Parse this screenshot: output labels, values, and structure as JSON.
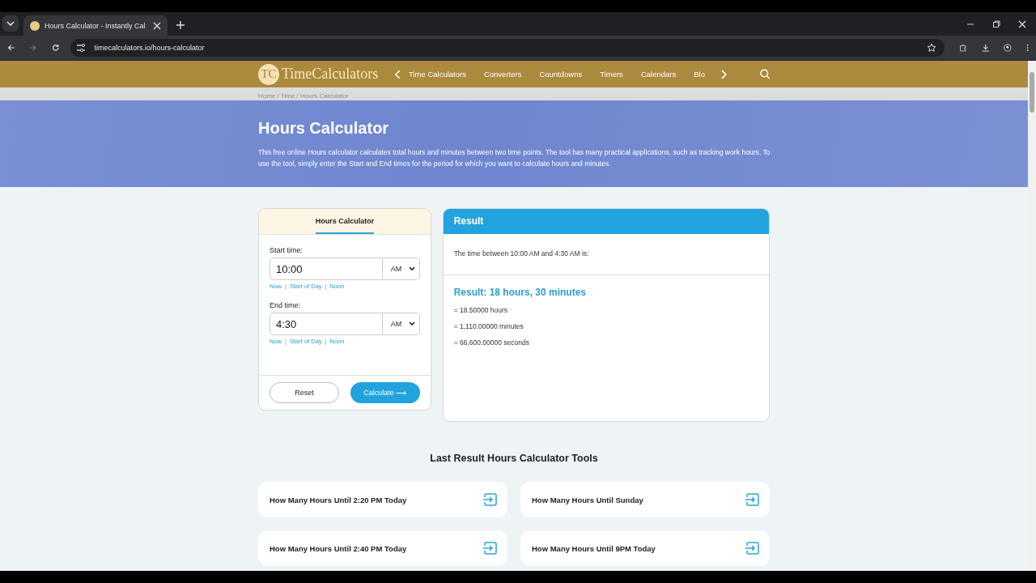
{
  "browser": {
    "tab_title": "Hours Calculator - Instantly Cal",
    "url": "timecalculators.io/hours-calculator"
  },
  "site": {
    "logo_mark": "TC",
    "brand": "TimeCalculators",
    "nav": [
      "Time Calculators",
      "Converters",
      "Countdowns",
      "Timers",
      "Calendars",
      "Blo"
    ]
  },
  "breadcrumb": "Home / Time / Hours Calculator",
  "hero": {
    "title": "Hours Calculator",
    "description": "This free online Hours calculator calculates total hours and minutes between two time points. The tool has many practical applications, such as tracking work hours. To use the tool, simply enter the Start and End times for the period for which you want to calculate hours and minutes."
  },
  "calculator": {
    "tabs": [
      {
        "label": "Hours Calculator",
        "selected": true
      }
    ],
    "fields": [
      {
        "label": "Start time:",
        "value": "10:00",
        "period": "AM",
        "links": [
          {
            "text": "Now",
            "kind": "link"
          },
          {
            "text": "|",
            "kind": "separator"
          },
          {
            "text": "Start of Day",
            "kind": "link"
          },
          {
            "text": "|",
            "kind": "separator"
          },
          {
            "text": "Noon",
            "kind": "link"
          }
        ]
      },
      {
        "label": "End time:",
        "value": "4:30",
        "period": "AM",
        "links": [
          {
            "text": "Now",
            "kind": "link"
          },
          {
            "text": "|",
            "kind": "separator"
          },
          {
            "text": "Start of Day",
            "kind": "link"
          },
          {
            "text": "|",
            "kind": "separator"
          },
          {
            "text": "Noon",
            "kind": "link"
          }
        ]
      }
    ],
    "buttons": [
      {
        "label": "Reset",
        "kind": "secondary"
      },
      {
        "label": "Calculate ⟶",
        "kind": "primary"
      }
    ]
  },
  "result": {
    "title": "Result",
    "summary": "The time between 10:00 AM and 4:30 AM is:",
    "headline": "Result: 18 hours, 30 minutes",
    "lines": [
      "= 18.50000 hours",
      "= 1,110.00000 minutes",
      "= 66,600.00000 seconds"
    ]
  },
  "tools": {
    "title": "Last Result Hours Calculator Tools",
    "items": [
      "How Many Hours Until 2:20 PM Today",
      "How Many Hours Until Sunday",
      "How Many Hours Until 2:40 PM Today",
      "How Many Hours Until 9PM Today"
    ]
  }
}
